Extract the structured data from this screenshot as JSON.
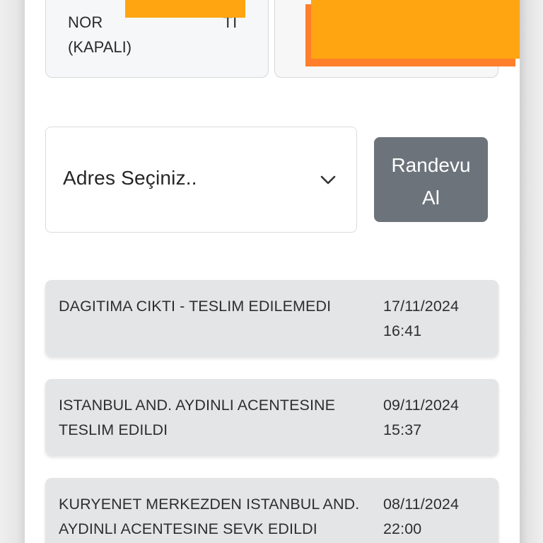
{
  "cards": {
    "left": {
      "line1_prefix": "NOR",
      "line1_suffix": "TI",
      "line2": "(KAPALI)"
    }
  },
  "address": {
    "placeholder": "Adres Seçiniz..",
    "icon": "chevron-down-icon"
  },
  "appointment": {
    "label": "Randevu Al"
  },
  "history": [
    {
      "status": "DAGITIMA CIKTI - TESLIM EDILEMEDI",
      "date": "17/11/2024",
      "time": "16:41"
    },
    {
      "status": "ISTANBUL AND. AYDINLI ACENTESINE TESLIM EDILDI",
      "date": "09/11/2024",
      "time": "15:37"
    },
    {
      "status": "KURYENET MERKEZDEN ISTANBUL AND. AYDINLI ACENTESINE SEVK EDILDI",
      "date": "08/11/2024",
      "time": "22:00"
    }
  ],
  "colors": {
    "redaction": "#ffa512",
    "redaction_shadow": "#ff7f2c",
    "button_background": "#6c737b",
    "history_background": "#e4e5e7"
  }
}
